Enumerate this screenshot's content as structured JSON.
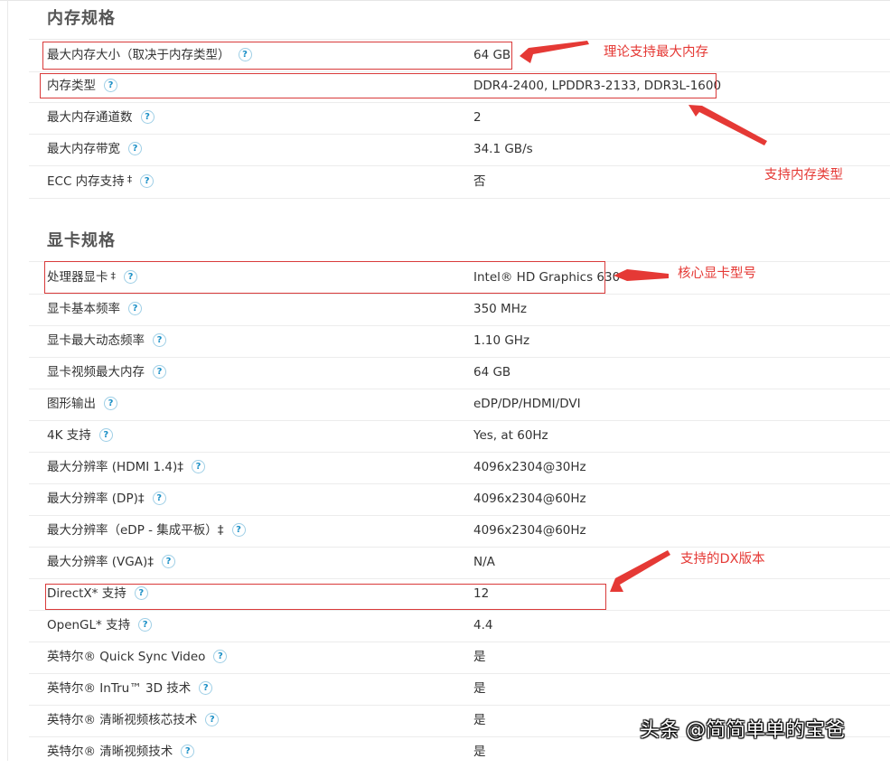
{
  "memory_section": {
    "title": "内存规格",
    "rows": [
      {
        "label": "最大内存大小（取决于内存类型）",
        "value": "64 GB"
      },
      {
        "label": "内存类型",
        "value": "DDR4-2400, LPDDR3-2133, DDR3L-1600"
      },
      {
        "label": "最大内存通道数",
        "value": "2"
      },
      {
        "label": "最大内存带宽",
        "value": "34.1 GB/s"
      },
      {
        "label": "ECC 内存支持",
        "value": "否",
        "marker": "‡"
      }
    ]
  },
  "graphics_section": {
    "title": "显卡规格",
    "rows": [
      {
        "label": "处理器显卡",
        "value": "Intel® HD Graphics 630",
        "marker": "‡"
      },
      {
        "label": "显卡基本频率",
        "value": "350 MHz"
      },
      {
        "label": "显卡最大动态频率",
        "value": "1.10 GHz"
      },
      {
        "label": "显卡视频最大内存",
        "value": "64 GB"
      },
      {
        "label": "图形输出",
        "value": "eDP/DP/HDMI/DVI"
      },
      {
        "label": "4K 支持",
        "value": "Yes, at 60Hz"
      },
      {
        "label": "最大分辨率 (HDMI 1.4)‡",
        "value": "4096x2304@30Hz"
      },
      {
        "label": "最大分辨率 (DP)‡",
        "value": "4096x2304@60Hz"
      },
      {
        "label": "最大分辨率（eDP - 集成平板）‡",
        "value": "4096x2304@60Hz"
      },
      {
        "label": "最大分辨率 (VGA)‡",
        "value": "N/A"
      },
      {
        "label": "DirectX* 支持",
        "value": "12"
      },
      {
        "label": "OpenGL* 支持",
        "value": "4.4"
      },
      {
        "label": "英特尔® Quick Sync Video",
        "value": "是"
      },
      {
        "label": "英特尔® InTru™ 3D 技术",
        "value": "是"
      },
      {
        "label": "英特尔® 清晰视频核芯技术",
        "value": "是"
      },
      {
        "label": "英特尔® 清晰视频技术",
        "value": "是"
      }
    ]
  },
  "help_icon": {
    "glyph": "?",
    "name": "help-circle-icon"
  },
  "annotations": {
    "max_memory": "理论支持最大内存",
    "memory_type": "支持内存类型",
    "gpu_model": "核心显卡型号",
    "dx_version": "支持的DX版本",
    "color": "#e53935"
  },
  "watermark": "头条 @简简单单的宝爸"
}
